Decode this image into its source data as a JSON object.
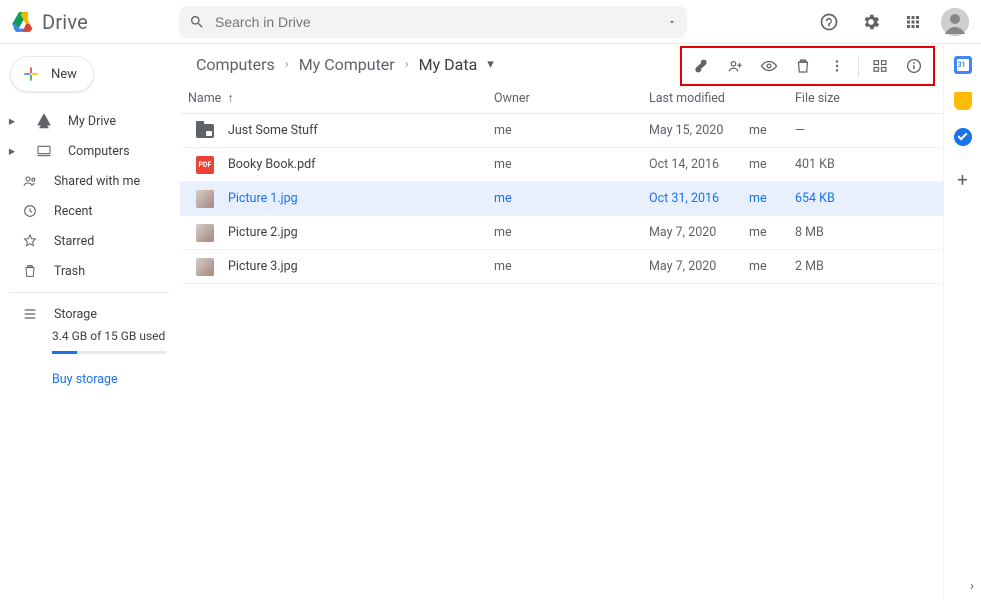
{
  "header": {
    "product": "Drive",
    "search_placeholder": "Search in Drive"
  },
  "new_button": {
    "label": "New"
  },
  "sidebar": {
    "items": [
      {
        "id": "my-drive",
        "label": "My Drive",
        "icon": "drive-icon",
        "caret": true
      },
      {
        "id": "computers",
        "label": "Computers",
        "icon": "computer-icon",
        "caret": true
      },
      {
        "id": "shared",
        "label": "Shared with me",
        "icon": "people-icon",
        "caret": false
      },
      {
        "id": "recent",
        "label": "Recent",
        "icon": "clock-icon",
        "caret": false
      },
      {
        "id": "starred",
        "label": "Starred",
        "icon": "star-icon",
        "caret": false
      },
      {
        "id": "trash",
        "label": "Trash",
        "icon": "trash-icon",
        "caret": false
      }
    ],
    "storage_label": "Storage",
    "storage_used_text": "3.4 GB of 15 GB used",
    "storage_pct": 22,
    "buy_storage_label": "Buy storage"
  },
  "breadcrumbs": [
    {
      "label": "Computers"
    },
    {
      "label": "My Computer"
    },
    {
      "label": "My Data"
    }
  ],
  "toolbar_icons": [
    "link-icon",
    "share-person-icon",
    "preview-eye-icon",
    "delete-trash-icon",
    "more-vert-icon",
    "grid-view-icon",
    "info-icon"
  ],
  "columns": {
    "name": "Name",
    "owner": "Owner",
    "modified": "Last modified",
    "size": "File size"
  },
  "files": [
    {
      "icon": "folder",
      "name": "Just Some Stuff",
      "owner": "me",
      "modified": "May 15, 2020",
      "modified_by": "me",
      "size": "—",
      "selected": false
    },
    {
      "icon": "pdf",
      "name": "Booky Book.pdf",
      "owner": "me",
      "modified": "Oct 14, 2016",
      "modified_by": "me",
      "size": "401 KB",
      "selected": false
    },
    {
      "icon": "image",
      "name": "Picture 1.jpg",
      "owner": "me",
      "modified": "Oct 31, 2016",
      "modified_by": "me",
      "size": "654 KB",
      "selected": true
    },
    {
      "icon": "image",
      "name": "Picture 2.jpg",
      "owner": "me",
      "modified": "May 7, 2020",
      "modified_by": "me",
      "size": "8 MB",
      "selected": false
    },
    {
      "icon": "image",
      "name": "Picture 3.jpg",
      "owner": "me",
      "modified": "May 7, 2020",
      "modified_by": "me",
      "size": "2 MB",
      "selected": false
    }
  ],
  "right_rail": {
    "items": [
      "calendar-app",
      "keep-app",
      "tasks-app"
    ],
    "add_label": "+"
  }
}
